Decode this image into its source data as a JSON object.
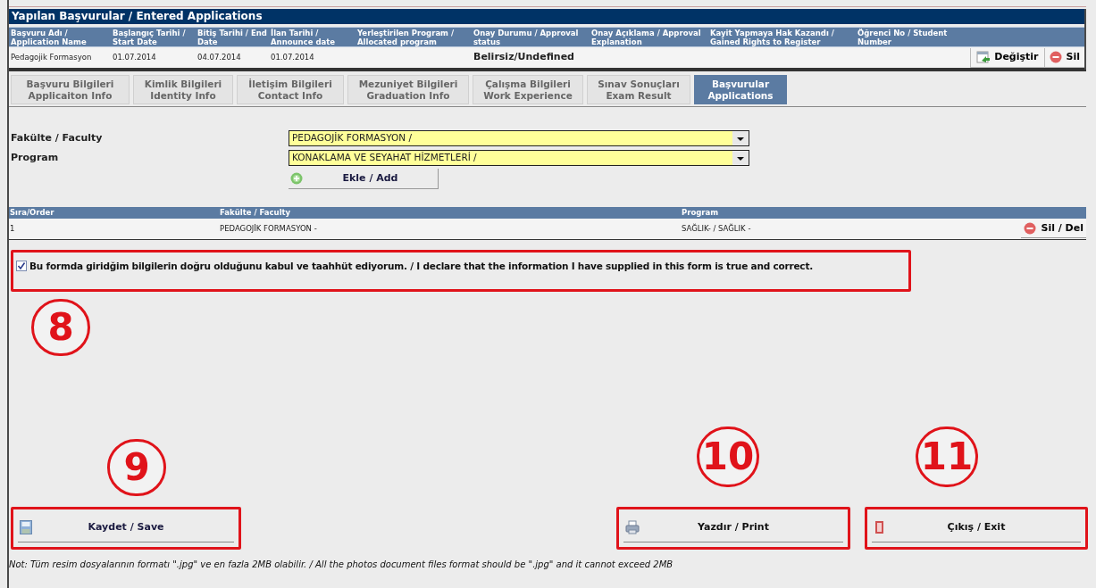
{
  "applications": {
    "title": "Yapılan Başvurular / Entered Applications",
    "columns": [
      "Başvuru Adı / Application Name",
      "Başlangıç Tarihi / Start Date",
      "Bitiş Tarihi / End Date",
      "İlan Tarihi / Announce date",
      "Yerleştirilen Program / Allocated program",
      "Onay Durumu / Approval status",
      "Onay Açıklama / Approval Explanation",
      "Kayit Yapmaya Hak Kazandı / Gained Rights to Register",
      "Öğrenci No / Student Number"
    ],
    "rows": [
      {
        "cells": [
          "Pedagojik Formasyon",
          "01.07.2014",
          "04.07.2014",
          "01.07.2014",
          "",
          "Belirsiz/Undefined",
          "",
          "",
          ""
        ],
        "edit": "Değiştir",
        "delete": "Sil"
      }
    ]
  },
  "tabs": [
    {
      "lines": [
        "Başvuru Bilgileri",
        "Applicaiton Info"
      ],
      "selected": false
    },
    {
      "lines": [
        "Kimlik Bilgileri",
        "Identity Info"
      ],
      "selected": false
    },
    {
      "lines": [
        "İletişim Bilgileri",
        "Contact Info"
      ],
      "selected": false
    },
    {
      "lines": [
        "Mezuniyet Bilgileri",
        "Graduation Info"
      ],
      "selected": false
    },
    {
      "lines": [
        "Çalışma Bilgileri",
        "Work Experience"
      ],
      "selected": false
    },
    {
      "lines": [
        "Sınav Sonuçları",
        "Exam Result"
      ],
      "selected": false
    },
    {
      "lines": [
        "Başvurular",
        "Applications"
      ],
      "selected": true
    }
  ],
  "form": {
    "fields": [
      {
        "label": "Fakülte / Faculty",
        "value": "PEDAGOJİK FORMASYON /"
      },
      {
        "label": "Program",
        "value": "KONAKLAMA VE SEYAHAT HİZMETLERİ /"
      }
    ],
    "add_button": "Ekle / Add"
  },
  "choices": {
    "columns": [
      "Sıra/Order",
      "Fakülte / Faculty",
      "Program"
    ],
    "rows": [
      {
        "cells": [
          "1",
          "PEDAGOJİK FORMASYON -",
          "SAĞLIK- / SAĞLIK -"
        ],
        "delete": "Sil / Del"
      }
    ]
  },
  "declaration": {
    "checked": true,
    "text": "Bu formda giridğim bilgilerin doğru olduğunu kabul ve taahhüt ediyorum. / I declare that the information I have supplied in this form is true and correct."
  },
  "buttons": [
    {
      "kind": "save",
      "label": "Kaydet / Save"
    },
    {
      "kind": "print",
      "label": "Yazdır / Print"
    },
    {
      "kind": "exit",
      "label": "Çıkış / Exit"
    }
  ],
  "note": "Not: Tüm resim dosyalarının formatı \".jpg\" ve en fazla 2MB olabilir. / All the photos document files format should be \".jpg\" and it cannot exceed 2MB",
  "annotations": [
    "8",
    "9",
    "10",
    "11"
  ]
}
